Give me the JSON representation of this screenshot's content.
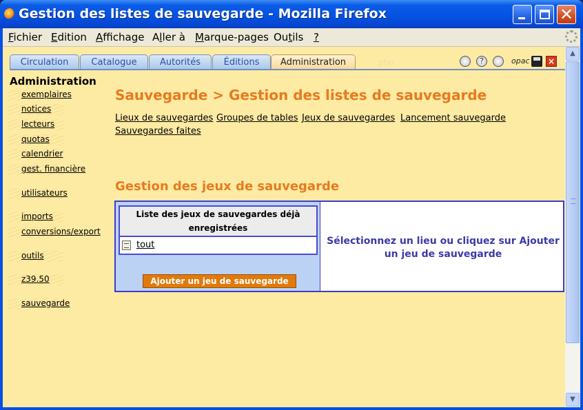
{
  "window": {
    "title": "Gestion des listes de sauvegarde - Mozilla Firefox"
  },
  "menu": [
    {
      "label_u": "F",
      "label_rest": "ichier"
    },
    {
      "label_u": "E",
      "label_rest": "dition"
    },
    {
      "label_u": "A",
      "label_rest": "ffichage"
    },
    {
      "label_pre": "A",
      "label_u": "l",
      "label_rest": "ler à"
    },
    {
      "label_u": "M",
      "label_rest": "arque-pages"
    },
    {
      "label_pre": "Ou",
      "label_u": "t",
      "label_rest": "ils"
    },
    {
      "label_u": "?",
      "label_rest": ""
    }
  ],
  "tabs": [
    "Circulation",
    "Catalogue",
    "Autorités",
    "Éditions",
    "Administration"
  ],
  "tab_ghost": "pbo",
  "toolbar_icons": [
    "clock-icon",
    "help-icon",
    "settings-icon",
    "opac-icon",
    "save-icon",
    "close-icon"
  ],
  "toolbar_opac_label": "opac",
  "toolbar_help_glyph": "?",
  "toolbar_close_glyph": "×",
  "sidebar": {
    "title": "Administration",
    "items": [
      "exemplaires",
      "notices",
      "lecteurs",
      "quotas",
      "calendrier",
      "gest. financière",
      "utilisateurs",
      "imports",
      "conversions/export",
      "outils",
      "z39.50",
      "sauvegarde"
    ]
  },
  "main": {
    "title": "Sauvegarde > Gestion des listes de sauvegarde",
    "sublinks": [
      "Lieux de sauvegardes",
      "Groupes de tables",
      "Jeux de sauvegardes",
      "Lancement sauvegarde",
      "Sauvegardes faites"
    ],
    "section_title": "Gestion des jeux de sauvegarde",
    "list_header": "Liste des jeux de sauvegardes déjà enregistrées",
    "list_items": [
      "tout"
    ],
    "add_button": "Ajouter un jeu de sauvegarde",
    "message": "Sélectionnez un lieu ou cliquez sur Ajouter un jeu de sauvegarde"
  }
}
